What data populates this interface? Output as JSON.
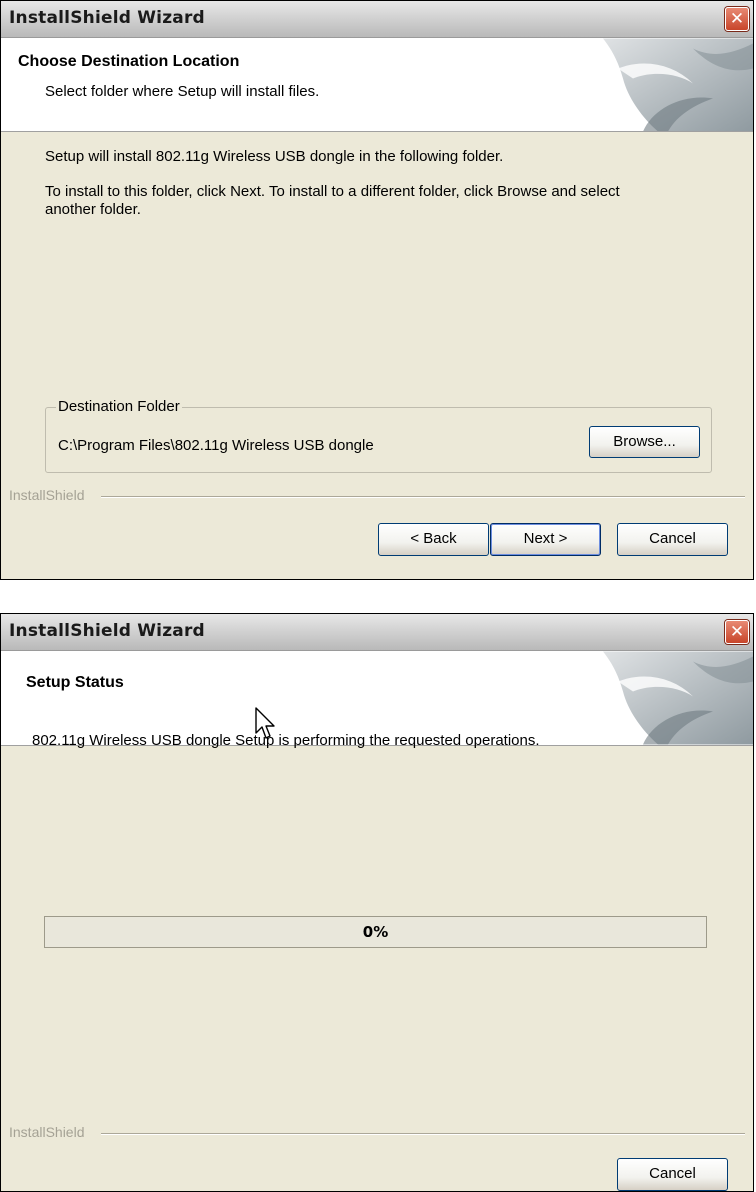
{
  "window1": {
    "title": "InstallShield Wizard",
    "close_glyph": "✕",
    "header_title": "Choose Destination Location",
    "header_subtitle": "Select folder where Setup will install files.",
    "line1": "Setup will install 802.11g Wireless USB dongle in the following folder.",
    "line2a": "To install to this folder, click Next. To install to a different folder, click Browse and select",
    "line2b": "another folder.",
    "group_label": "Destination Folder",
    "install_path": "C:\\Program Files\\802.11g Wireless USB dongle",
    "browse_label": "Browse...",
    "brand": "InstallShield",
    "back_label": "< Back",
    "next_label": "Next >",
    "cancel_label": "Cancel"
  },
  "window2": {
    "title": "InstallShield Wizard",
    "close_glyph": "✕",
    "header_title": "Setup Status",
    "status_text": "802.11g Wireless USB dongle Setup is performing the requested operations.",
    "progress_percent": 0,
    "progress_label": "0%",
    "brand": "InstallShield",
    "cancel_label": "Cancel"
  },
  "colors": {
    "dialog_bg": "#ece9d8",
    "progress_fill": "#2f5bd6",
    "close_red": "#c8452a"
  },
  "icons": [
    "close-icon",
    "installshield-logo",
    "mouse-cursor-icon"
  ]
}
